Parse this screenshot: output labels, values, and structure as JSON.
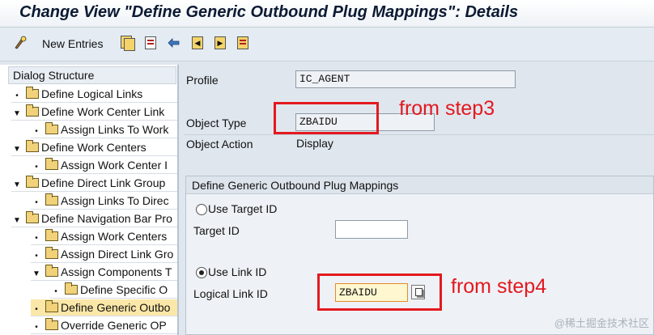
{
  "window": {
    "title": "Change View \"Define Generic Outbound Plug Mappings\": Details"
  },
  "toolbar": {
    "items": [
      {
        "icon": "glasses-icon"
      },
      {
        "label": "New Entries"
      },
      {
        "icon": "copy-icon"
      },
      {
        "icon": "delete-icon"
      },
      {
        "icon": "undo-icon"
      },
      {
        "icon": "previous-entry-icon"
      },
      {
        "icon": "next-entry-icon"
      },
      {
        "icon": "select-all-icon"
      }
    ]
  },
  "tree": {
    "header": "Dialog Structure",
    "items": [
      {
        "label": "Define Logical Links",
        "marker": "•"
      },
      {
        "label": "Define Work Center Link",
        "marker": "▼"
      },
      {
        "label": "Assign Links To Work",
        "marker": "•"
      },
      {
        "label": "Define Work Centers",
        "marker": "▼"
      },
      {
        "label": "Assign Work Center I",
        "marker": "•"
      },
      {
        "label": "Define Direct Link Group",
        "marker": "▼"
      },
      {
        "label": "Assign Links To Direc",
        "marker": "•"
      },
      {
        "label": "Define Navigation Bar Pro",
        "marker": "▼"
      },
      {
        "label": "Assign Work Centers",
        "marker": "•"
      },
      {
        "label": "Assign Direct Link Gro",
        "marker": "•"
      },
      {
        "label": "Assign Components T",
        "marker": "▼"
      },
      {
        "label": "Define Specific O",
        "marker": "•"
      },
      {
        "label": "Define Generic Outbo",
        "marker": "•",
        "selected": true
      },
      {
        "label": "Override Generic OP",
        "marker": "•"
      }
    ]
  },
  "details": {
    "profile_label": "Profile",
    "profile_value": "IC_AGENT",
    "object_type_label": "Object Type",
    "object_type_value": "ZBAIDU",
    "object_action_label": "Object Action",
    "object_action_value": "Display"
  },
  "group": {
    "title": "Define Generic Outbound Plug Mappings",
    "use_target_label": "Use Target ID",
    "target_id_label": "Target ID",
    "target_id_value": "",
    "use_link_label": "Use Link ID",
    "logical_link_label": "Logical Link ID",
    "logical_link_value": "ZBAIDU",
    "selected_option": "Use Link ID"
  },
  "annotations": {
    "step3": "from step3",
    "step4": "from step4",
    "color": "#e3191f"
  },
  "watermark": "@稀土掘金技术社区"
}
